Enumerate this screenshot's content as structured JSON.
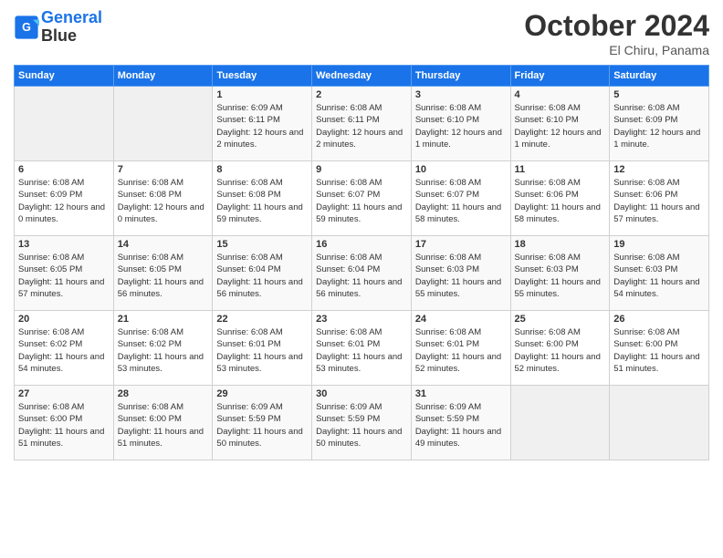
{
  "header": {
    "logo_line1": "General",
    "logo_line2": "Blue",
    "month": "October 2024",
    "location": "El Chiru, Panama"
  },
  "days_of_week": [
    "Sunday",
    "Monday",
    "Tuesday",
    "Wednesday",
    "Thursday",
    "Friday",
    "Saturday"
  ],
  "weeks": [
    [
      {
        "day": "",
        "info": ""
      },
      {
        "day": "",
        "info": ""
      },
      {
        "day": "1",
        "sunrise": "6:09 AM",
        "sunset": "6:11 PM",
        "daylight": "12 hours and 2 minutes."
      },
      {
        "day": "2",
        "sunrise": "6:08 AM",
        "sunset": "6:11 PM",
        "daylight": "12 hours and 2 minutes."
      },
      {
        "day": "3",
        "sunrise": "6:08 AM",
        "sunset": "6:10 PM",
        "daylight": "12 hours and 1 minute."
      },
      {
        "day": "4",
        "sunrise": "6:08 AM",
        "sunset": "6:10 PM",
        "daylight": "12 hours and 1 minute."
      },
      {
        "day": "5",
        "sunrise": "6:08 AM",
        "sunset": "6:09 PM",
        "daylight": "12 hours and 1 minute."
      }
    ],
    [
      {
        "day": "6",
        "sunrise": "6:08 AM",
        "sunset": "6:09 PM",
        "daylight": "12 hours and 0 minutes."
      },
      {
        "day": "7",
        "sunrise": "6:08 AM",
        "sunset": "6:08 PM",
        "daylight": "12 hours and 0 minutes."
      },
      {
        "day": "8",
        "sunrise": "6:08 AM",
        "sunset": "6:08 PM",
        "daylight": "11 hours and 59 minutes."
      },
      {
        "day": "9",
        "sunrise": "6:08 AM",
        "sunset": "6:07 PM",
        "daylight": "11 hours and 59 minutes."
      },
      {
        "day": "10",
        "sunrise": "6:08 AM",
        "sunset": "6:07 PM",
        "daylight": "11 hours and 58 minutes."
      },
      {
        "day": "11",
        "sunrise": "6:08 AM",
        "sunset": "6:06 PM",
        "daylight": "11 hours and 58 minutes."
      },
      {
        "day": "12",
        "sunrise": "6:08 AM",
        "sunset": "6:06 PM",
        "daylight": "11 hours and 57 minutes."
      }
    ],
    [
      {
        "day": "13",
        "sunrise": "6:08 AM",
        "sunset": "6:05 PM",
        "daylight": "11 hours and 57 minutes."
      },
      {
        "day": "14",
        "sunrise": "6:08 AM",
        "sunset": "6:05 PM",
        "daylight": "11 hours and 56 minutes."
      },
      {
        "day": "15",
        "sunrise": "6:08 AM",
        "sunset": "6:04 PM",
        "daylight": "11 hours and 56 minutes."
      },
      {
        "day": "16",
        "sunrise": "6:08 AM",
        "sunset": "6:04 PM",
        "daylight": "11 hours and 56 minutes."
      },
      {
        "day": "17",
        "sunrise": "6:08 AM",
        "sunset": "6:03 PM",
        "daylight": "11 hours and 55 minutes."
      },
      {
        "day": "18",
        "sunrise": "6:08 AM",
        "sunset": "6:03 PM",
        "daylight": "11 hours and 55 minutes."
      },
      {
        "day": "19",
        "sunrise": "6:08 AM",
        "sunset": "6:03 PM",
        "daylight": "11 hours and 54 minutes."
      }
    ],
    [
      {
        "day": "20",
        "sunrise": "6:08 AM",
        "sunset": "6:02 PM",
        "daylight": "11 hours and 54 minutes."
      },
      {
        "day": "21",
        "sunrise": "6:08 AM",
        "sunset": "6:02 PM",
        "daylight": "11 hours and 53 minutes."
      },
      {
        "day": "22",
        "sunrise": "6:08 AM",
        "sunset": "6:01 PM",
        "daylight": "11 hours and 53 minutes."
      },
      {
        "day": "23",
        "sunrise": "6:08 AM",
        "sunset": "6:01 PM",
        "daylight": "11 hours and 53 minutes."
      },
      {
        "day": "24",
        "sunrise": "6:08 AM",
        "sunset": "6:01 PM",
        "daylight": "11 hours and 52 minutes."
      },
      {
        "day": "25",
        "sunrise": "6:08 AM",
        "sunset": "6:00 PM",
        "daylight": "11 hours and 52 minutes."
      },
      {
        "day": "26",
        "sunrise": "6:08 AM",
        "sunset": "6:00 PM",
        "daylight": "11 hours and 51 minutes."
      }
    ],
    [
      {
        "day": "27",
        "sunrise": "6:08 AM",
        "sunset": "6:00 PM",
        "daylight": "11 hours and 51 minutes."
      },
      {
        "day": "28",
        "sunrise": "6:08 AM",
        "sunset": "6:00 PM",
        "daylight": "11 hours and 51 minutes."
      },
      {
        "day": "29",
        "sunrise": "6:09 AM",
        "sunset": "5:59 PM",
        "daylight": "11 hours and 50 minutes."
      },
      {
        "day": "30",
        "sunrise": "6:09 AM",
        "sunset": "5:59 PM",
        "daylight": "11 hours and 50 minutes."
      },
      {
        "day": "31",
        "sunrise": "6:09 AM",
        "sunset": "5:59 PM",
        "daylight": "11 hours and 49 minutes."
      },
      {
        "day": "",
        "info": ""
      },
      {
        "day": "",
        "info": ""
      }
    ]
  ]
}
